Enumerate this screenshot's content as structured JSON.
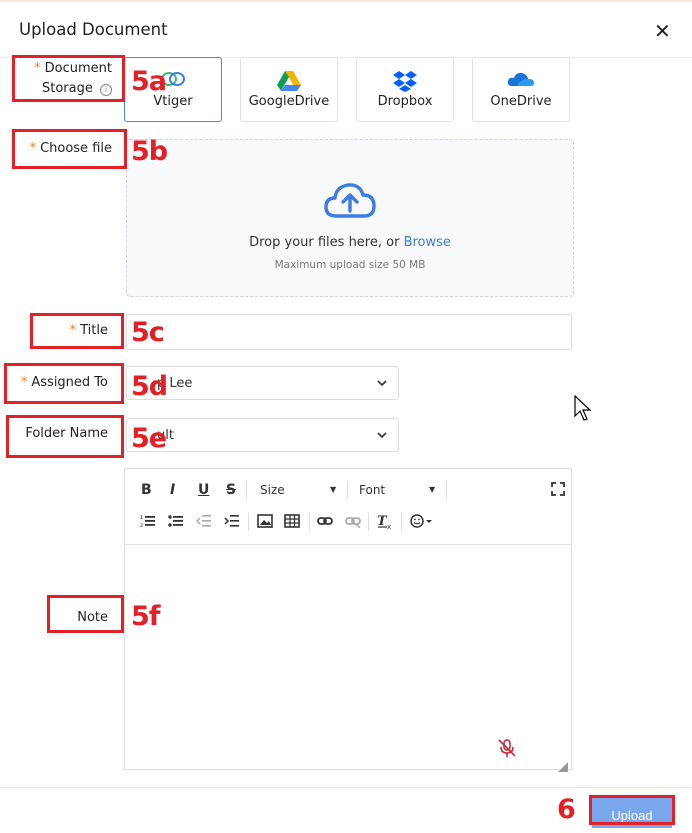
{
  "dialog": {
    "title": "Upload Document",
    "close": "✕"
  },
  "labels": {
    "storage_line1": "Document",
    "storage_line2": "Storage",
    "choose_file": "Choose file",
    "title": "Title",
    "assigned_to": "Assigned To",
    "folder_name": "Folder Name",
    "note": "Note",
    "required_mark": "*",
    "info_mark": "i"
  },
  "storage_options": [
    {
      "label": "Vtiger",
      "icon": "vtiger-logo-icon",
      "selected": true
    },
    {
      "label": "GoogleDrive",
      "icon": "google-drive-icon",
      "selected": false
    },
    {
      "label": "Dropbox",
      "icon": "dropbox-icon",
      "selected": false
    },
    {
      "label": "OneDrive",
      "icon": "onedrive-icon",
      "selected": false
    }
  ],
  "dropzone": {
    "text": "Drop your files here, or ",
    "link": "Browse",
    "hint": "Maximum upload size 50 MB"
  },
  "fields": {
    "title_value": "",
    "assigned_to_value": "p Lee",
    "folder_value": "ult"
  },
  "editor_toolbar": {
    "bold": "B",
    "italic": "I",
    "underline": "U",
    "strike": "S",
    "size": "Size",
    "font": "Font"
  },
  "annotations": {
    "s5a": "5a",
    "s5b": "5b",
    "s5c": "5c",
    "s5d": "5d",
    "s5e": "5e",
    "s5f": "5f",
    "s6": "6"
  },
  "footer": {
    "upload_label": "Upload"
  },
  "colors": {
    "required": "#f0811f",
    "link": "#3b7de0",
    "annotation": "#e32025",
    "upload_button": "#7aa6ee",
    "selected_border": "#4a87d8"
  }
}
